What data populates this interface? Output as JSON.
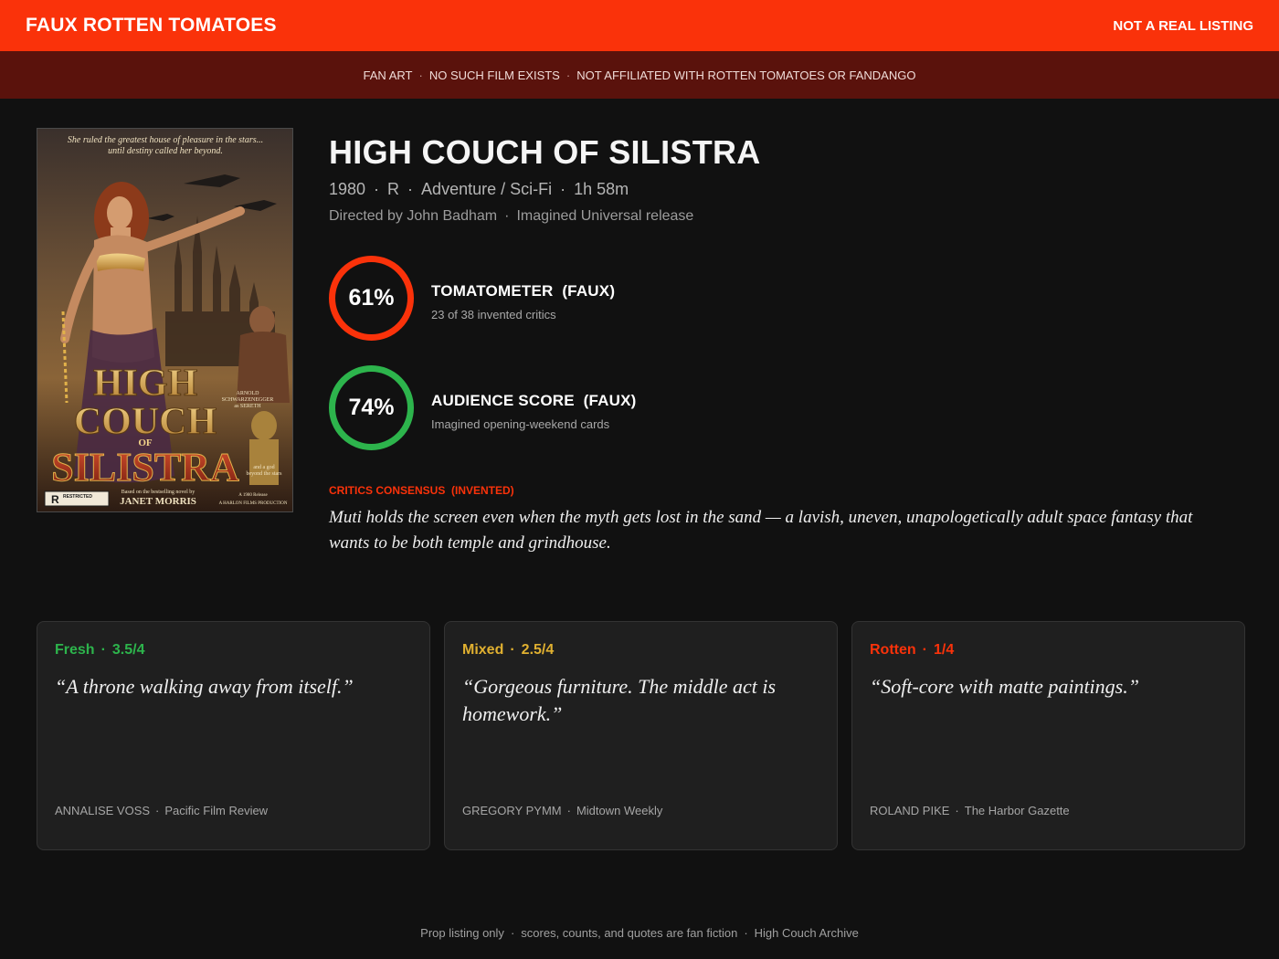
{
  "header": {
    "brand": "FAUX ROTTEN TOMATOES",
    "notice": "NOT A REAL LISTING"
  },
  "disclaimer": {
    "items": [
      "FAN ART",
      "NO SUCH FILM EXISTS",
      "NOT AFFILIATED WITH ROTTEN TOMATOES OR FANDANGO"
    ],
    "separator": "·"
  },
  "poster": {
    "tagline_1": "She ruled the greatest house of pleasure in the stars...",
    "tagline_2": "until destiny called her beyond.",
    "title_1": "HIGH",
    "title_2": "COUCH",
    "title_of": "OF",
    "title_3": "SILISTRA",
    "credit_1": "ARNOLD",
    "credit_2": "SCHWARZENEGGER",
    "credit_3": "as SERETH",
    "credit_4": "and a god",
    "credit_5": "beyond the stars",
    "rating_box": "R",
    "rating_word": "RESTRICTED",
    "novel_line": "Based on the bestselling novel by",
    "novelist": "JANET MORRIS",
    "release_1": "A 1980 Release",
    "release_2": "A HARLON FILMS PRODUCTION"
  },
  "movie": {
    "title": "HIGH COUCH OF SILISTRA",
    "year": "1980",
    "rating": "R",
    "genre": "Adventure / Sci-Fi",
    "runtime": "1h 58m",
    "director": "Directed by John Badham",
    "release": "Imagined Universal release"
  },
  "scores": {
    "tomatometer": {
      "value": "61%",
      "percent": 61,
      "label": "TOMATOMETER  (FAUX)",
      "sub": "23 of 38 invented critics",
      "color": "#fa320a"
    },
    "audience": {
      "value": "74%",
      "percent": 74,
      "label": "AUDIENCE SCORE  (FAUX)",
      "sub": "Imagined opening-weekend cards",
      "color": "#2db44c"
    }
  },
  "consensus": {
    "heading": "CRITICS CONSENSUS  (INVENTED)",
    "text": "Muti holds the screen even when the myth gets lost in the sand — a lavish, uneven, unapologetically adult space fantasy that wants to be both temple and grindhouse."
  },
  "reviews": [
    {
      "verdict": "Fresh",
      "score": "3.5/4",
      "quote": "“A throne walking away from itself.”",
      "critic": "ANNALISE VOSS",
      "outlet": "Pacific Film Review",
      "color": "#2db44c"
    },
    {
      "verdict": "Mixed",
      "score": "2.5/4",
      "quote": "“Gorgeous furniture. The middle act is homework.”",
      "critic": "GREGORY PYMM",
      "outlet": "Midtown Weekly",
      "color": "#e0b030"
    },
    {
      "verdict": "Rotten",
      "score": "1/4",
      "quote": "“Soft-core with matte paintings.”",
      "critic": "ROLAND PIKE",
      "outlet": "The Harbor Gazette",
      "color": "#fa320a"
    }
  ],
  "footer": {
    "items": [
      "Prop listing only",
      "scores, counts, and quotes are fan fiction",
      "High Couch Archive"
    ],
    "separator": "·"
  }
}
